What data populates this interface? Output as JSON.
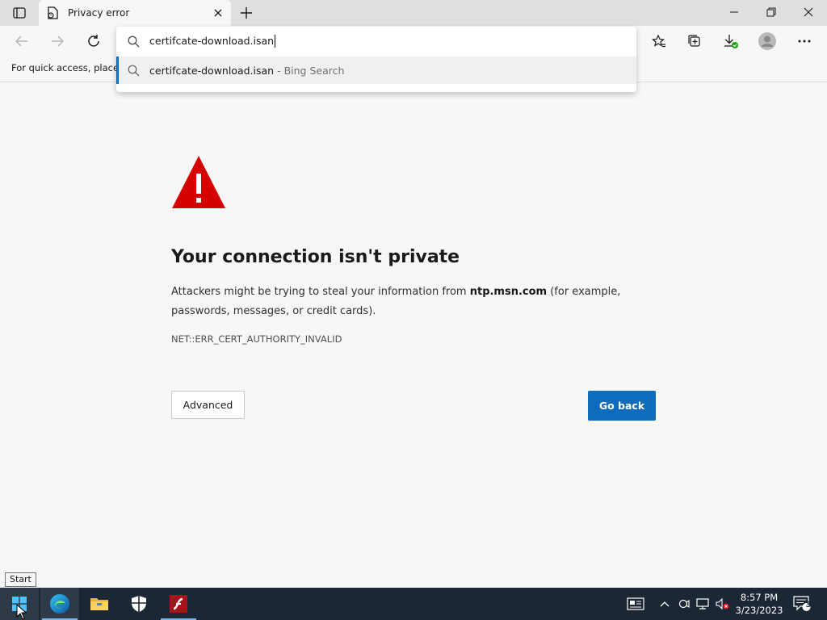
{
  "browser": {
    "tab_title": "Privacy error",
    "favorites_bar_text": "For quick access, place y"
  },
  "omnibox": {
    "input_value": "certifcate-download.isan",
    "suggestion_text": "certifcate-download.isan",
    "suggestion_suffix": " - Bing Search"
  },
  "error_page": {
    "heading": "Your connection isn't private",
    "body_before": "Attackers might be trying to steal your information from ",
    "host": "ntp.msn.com",
    "body_after": " (for example, passwords, messages, or credit cards).",
    "error_code": "NET::ERR_CERT_AUTHORITY_INVALID",
    "advanced_label": "Advanced",
    "go_back_label": "Go back"
  },
  "tooltip": "Start",
  "taskbar": {
    "time": "8:57 PM",
    "date": "3/23/2023",
    "notification_count": "3"
  },
  "colors": {
    "accent": "#0f6cbd",
    "warning": "#d50000",
    "taskbar": "#1c2735"
  }
}
